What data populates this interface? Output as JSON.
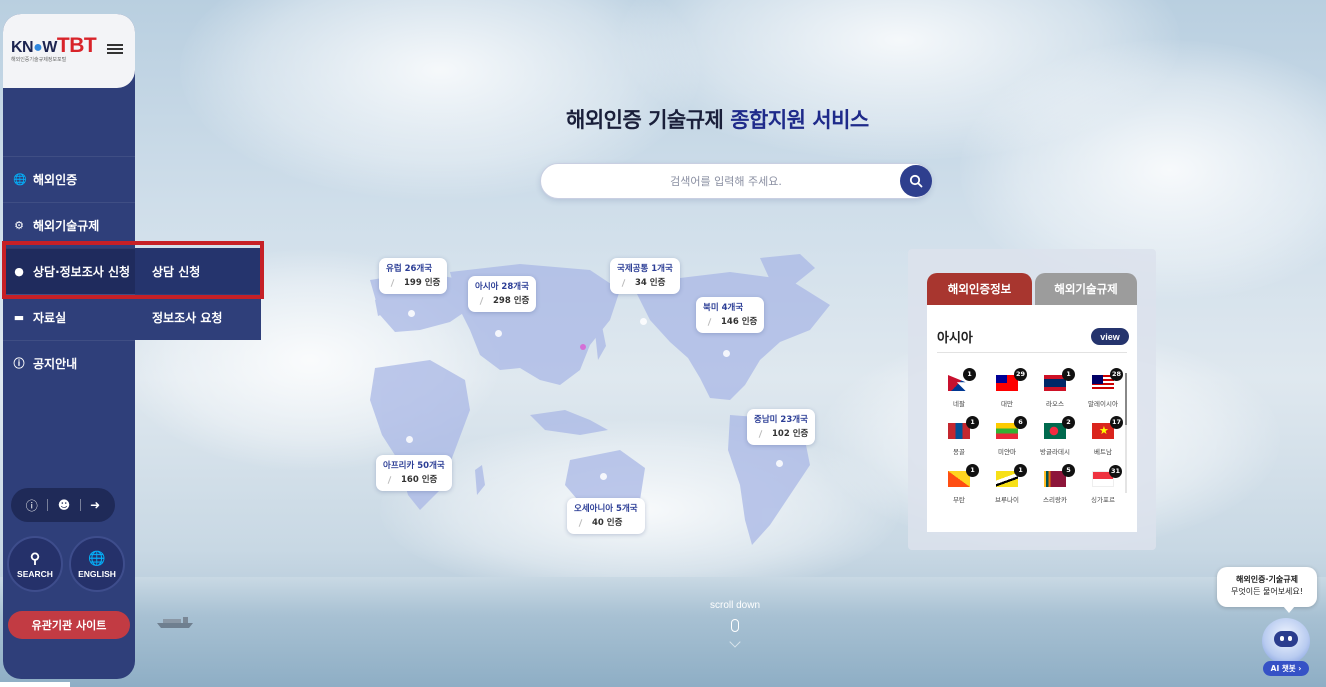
{
  "logo": {
    "brand_a": "KN",
    "brand_b": "W",
    "brand_c": "TBT",
    "subtitle": "해외인증기술규제정보포털"
  },
  "sidebar": {
    "menu": [
      {
        "label": "해외인증",
        "icon": "globe-icon"
      },
      {
        "label": "해외기술규제",
        "icon": "gear-icon"
      },
      {
        "label": "상담·정보조사 신청",
        "icon": "chat-icon"
      },
      {
        "label": "자료실",
        "icon": "folder-icon"
      },
      {
        "label": "공지안내",
        "icon": "info-icon"
      }
    ],
    "submenu": [
      {
        "label": "상담 신청"
      },
      {
        "label": "정보조사 요청"
      }
    ],
    "search_label": "SEARCH",
    "english_label": "ENGLISH",
    "related_sites": "유관기관 사이트"
  },
  "hero": {
    "title_a": "해외인증 기술규제 ",
    "title_b": "종합지원 서비스",
    "search_placeholder": "검색어를 입력해 주세요."
  },
  "regions": [
    {
      "name": "유럽 26개국",
      "count": "199 인증"
    },
    {
      "name": "아시아 28개국",
      "count": "298 인증"
    },
    {
      "name": "국제공통 1개국",
      "count": "34 인증"
    },
    {
      "name": "북미 4개국",
      "count": "146 인증"
    },
    {
      "name": "중남미 23개국",
      "count": "102 인증"
    },
    {
      "name": "아프리카 50개국",
      "count": "160 인증"
    },
    {
      "name": "오세아니아 5개국",
      "count": "40 인증"
    }
  ],
  "panel": {
    "tab_active": "해외인증정보",
    "tab_inactive": "해외기술규제",
    "heading": "아시아",
    "view": "view",
    "countries": [
      {
        "name": "네팔",
        "count": "1"
      },
      {
        "name": "대만",
        "count": "29"
      },
      {
        "name": "라오스",
        "count": "1"
      },
      {
        "name": "말레이시아",
        "count": "28"
      },
      {
        "name": "몽골",
        "count": "1"
      },
      {
        "name": "미얀마",
        "count": "6"
      },
      {
        "name": "방글라데시",
        "count": "2"
      },
      {
        "name": "베트남",
        "count": "17"
      },
      {
        "name": "부탄",
        "count": "1"
      },
      {
        "name": "브루나이",
        "count": "1"
      },
      {
        "name": "스리랑카",
        "count": "5"
      },
      {
        "name": "싱가포르",
        "count": "31"
      }
    ]
  },
  "scroll_down": "scroll down",
  "chatbot": {
    "line1": "해외인증·기술규제",
    "line2": "무엇이든 물어보세요!",
    "button": "AI 챗봇 ›"
  },
  "colors": {
    "navy": "#2f3f7a",
    "accent_red": "#c62026",
    "tab_red": "#a8362f"
  }
}
